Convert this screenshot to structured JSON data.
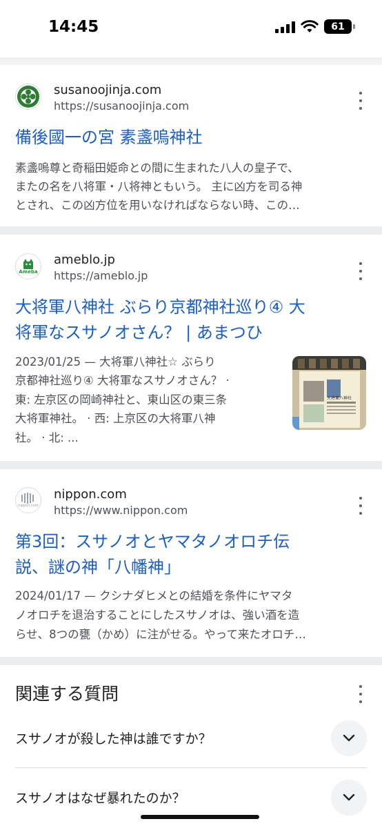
{
  "status_bar": {
    "time": "14:45",
    "battery": "61"
  },
  "results": [
    {
      "site_name": "susanoojinja.com",
      "url": "https://susanoojinja.com",
      "title_lines": [
        "備後國一の宮 素盞嗚神社"
      ],
      "snippet_lines": [
        "素盞嗚尊と奇稲田姫命との間に生まれた八人の皇子で、",
        "またの名を八将軍・八将神ともいう。 主に凶方を司る神",
        "とされ、この凶方位を用いなければならない時、この…"
      ]
    },
    {
      "site_name": "ameblo.jp",
      "url": "https://ameblo.jp",
      "favicon_text": "Ameba",
      "title_lines": [
        "大将軍八神社 ぶらり京都神社巡り④ 大",
        "将軍なスサノオさん？ | あまつひ"
      ],
      "snippet_lines": [
        "2023/01/25 — 大将軍八神社☆ ぶらり",
        "京都神社巡り④ 大将軍なスサノオさん？ ·",
        "東: 左京区の岡崎神社と、東山区の東三条",
        "大将軍神社。 · 西: 上京区の大将軍八神",
        "社。 · 北: ..."
      ],
      "thumbnail_caption": "大将軍八神社"
    },
    {
      "site_name": "nippon.com",
      "url": "https://www.nippon.com",
      "favicon_text": "nippon.com",
      "title_lines": [
        "第3回：スサノオとヤマタノオロチ伝",
        "説、謎の神「八幡神」"
      ],
      "snippet_lines": [
        "2024/01/17 — クシナダヒメとの結婚を条件にヤマタ",
        "ノオロチを退治することにしたスサノオは、強い酒を造",
        "らせ、8つの甕（かめ）に注がせる。やって来たオロチ…"
      ]
    }
  ],
  "related": {
    "title": "関連する質問",
    "questions": [
      "スサノオが殺した神は誰ですか？",
      "スサノオはなぜ暴れたのか？"
    ]
  },
  "colors": {
    "link": "#1a5fc9",
    "snippet": "#4d5156",
    "separator": "#ebedef"
  }
}
